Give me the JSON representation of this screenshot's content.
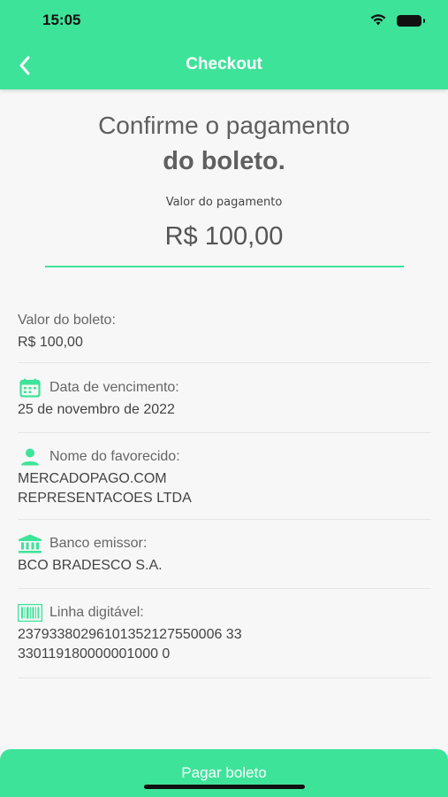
{
  "status": {
    "time": "15:05"
  },
  "header": {
    "title": "Checkout",
    "accent_color": "#3ee39a"
  },
  "confirm": {
    "line1": "Confirme o pagamento",
    "line2": "do boleto.",
    "amount_label": "Valor do pagamento",
    "amount_value": "R$ 100,00"
  },
  "details": {
    "valor": {
      "label": "Valor do boleto:",
      "value": "R$ 100,00"
    },
    "vencimento": {
      "label": "Data de vencimento:",
      "value": "25 de novembro de 2022",
      "icon": "calendar-icon"
    },
    "favorecido": {
      "label": "Nome do favorecido:",
      "value_line1": "MERCADOPAGO.COM",
      "value_line2": "REPRESENTACOES LTDA",
      "icon": "person-icon"
    },
    "banco": {
      "label": "Banco emissor:",
      "value": "BCO BRADESCO S.A.",
      "icon": "bank-icon"
    },
    "linha": {
      "label": "Linha digitável:",
      "value_line1": "23793380296101352127550006 33",
      "value_line2": "330119180000001000 0",
      "icon": "barcode-icon"
    }
  },
  "actions": {
    "pay_label": "Pagar boleto"
  }
}
